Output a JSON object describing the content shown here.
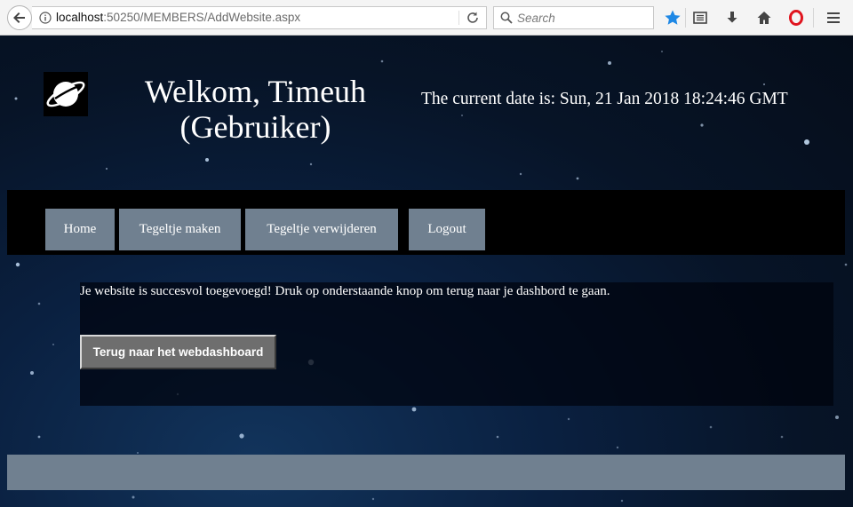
{
  "browser": {
    "url_host": "localhost",
    "url_rest": ":50250/MEMBERS/AddWebsite.aspx",
    "search_placeholder": "Search"
  },
  "header": {
    "welcome_line1": "Welkom, Timeuh",
    "welcome_line2": "(Gebruiker)",
    "date_text": "The current date is: Sun, 21 Jan 2018 18:24:46 GMT"
  },
  "nav": {
    "items": [
      {
        "label": "Home"
      },
      {
        "label": "Tegeltje maken"
      },
      {
        "label": "Tegeltje verwijderen"
      },
      {
        "label": "Logout"
      }
    ]
  },
  "main": {
    "message": "Je website is succesvol toegevoegd! Druk op onderstaande knop om terug naar je dashbord te gaan.",
    "button_label": "Terug naar het webdashboard"
  },
  "colors": {
    "nav_button": "#708090",
    "footer": "#708090",
    "bookmark_star": "#1e88e5",
    "opera_red": "#e0141e"
  }
}
